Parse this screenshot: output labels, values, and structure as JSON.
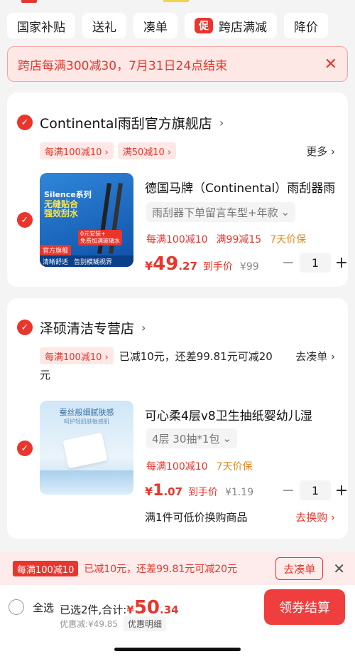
{
  "chips": [
    {
      "label": "国家补贴"
    },
    {
      "label": "送礼"
    },
    {
      "label": "凑单"
    },
    {
      "label": "跨店满减",
      "icon": "促"
    },
    {
      "label": "降价"
    }
  ],
  "banner": {
    "text": "跨店每满300减30，7月31日24点结束"
  },
  "stores": [
    {
      "name": "Continental雨刮官方旗舰店",
      "promos": [
        "每满100减10 ›",
        "满50减10 ›"
      ],
      "more": "更多 ›",
      "product": {
        "title": "德国马牌（Continental）雨刮器雨",
        "sku": "雨刮器下单留言车型+年款",
        "tags": [
          "每满100减10",
          "满99减15",
          "7天价保"
        ],
        "price_cur": "¥",
        "price_big": "49",
        "price_small": ".27",
        "price_tip": "到手价",
        "orig_price": "¥99",
        "qty": "1",
        "img_text": [
          "Silence系列",
          "无缝贴合",
          "强效刮水",
          "官方旗舰",
          "清晰舒适",
          "告别模糊视界",
          "0元安装+",
          "免费加满玻璃水"
        ]
      }
    },
    {
      "name": "泽硕清洁专营店",
      "promo": "每满100减10 ›",
      "promo_text": "已减10元，还差99.81元可减20",
      "promo_wrap": "元",
      "go": "去凑单 ›",
      "product": {
        "title": "可心柔4层v8卫生抽纸婴幼儿湿",
        "sku": "4层 30抽*1包",
        "tags": [
          "每满100减10",
          "7天价保"
        ],
        "price_cur": "¥",
        "price_big": "1",
        "price_small": ".07",
        "price_tip": "到手价",
        "orig_price": "¥1.19",
        "qty": "1",
        "img_text": [
          "蚕丝般细腻肤感",
          "呵护轻肌肤敏感肌"
        ]
      },
      "exchange": "满1件可低价换购商品",
      "exchange_btn": "去换购 ›"
    }
  ],
  "promobar": {
    "label": "每满100减10",
    "text": "已减10元，还差99.81元可减20元",
    "btn": "去凑单"
  },
  "footer": {
    "select_all": "全选",
    "chosen_prefix": "已选2件,合计:",
    "total_cur": "¥",
    "total_big": "50",
    "total_small": ".34",
    "discount": "优惠减:¥49.85",
    "detail": "优惠明细",
    "pay": "领券结算"
  },
  "colors": {
    "accent": "#e8362c"
  }
}
